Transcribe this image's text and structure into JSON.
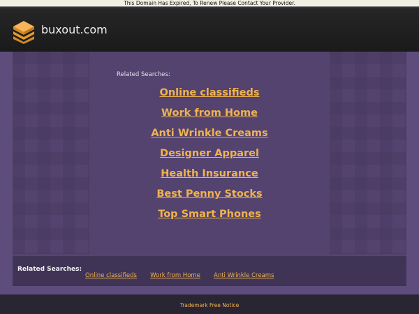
{
  "notice": "This Domain Has Expired, To Renew Please Contact Your Provider.",
  "header": {
    "site_name": "buxout.com",
    "logo_icon": "stacked-layers-logo-icon"
  },
  "main": {
    "related_label": "Related Searches:",
    "links": [
      "Online classifieds",
      "Work from Home",
      "Anti Wrinkle Creams",
      "Designer Apparel",
      "Health Insurance",
      "Best Penny Stocks",
      "Top Smart Phones"
    ]
  },
  "bottom": {
    "label": "Related Searches:",
    "links": [
      "Online classifieds",
      "Work from Home",
      "Anti Wrinkle Creams"
    ]
  },
  "footer": {
    "link": "Trademark Free Notice"
  },
  "colors": {
    "link": "#f0b34d",
    "background": "#5e4d7c",
    "header": "#1f1f1f"
  }
}
